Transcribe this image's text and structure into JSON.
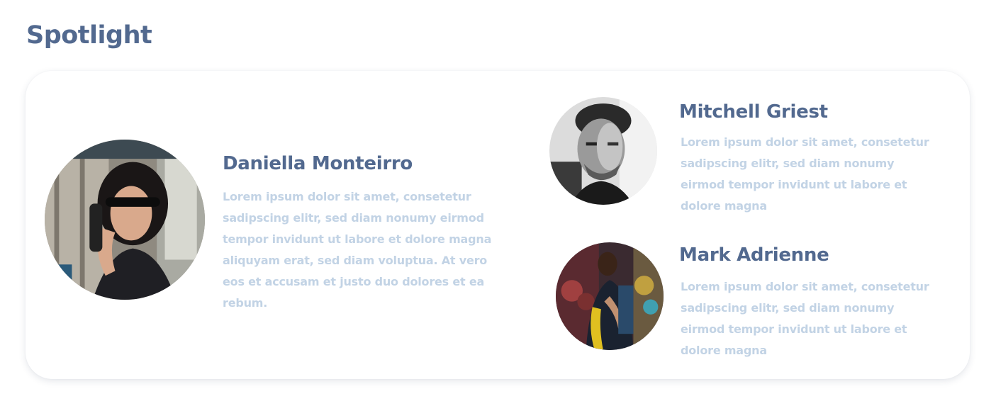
{
  "section": {
    "title": "Spotlight"
  },
  "people": [
    {
      "name": "Daniella Monteirro",
      "bio": "Lorem ipsum dolor sit amet, consetetur sadipscing elitr, sed diam nonumy eirmod tempor invidunt ut labore et dolore magna aliquyam erat, sed diam voluptua. At vero eos et accusam et justo duo dolores et ea rebum.",
      "avatar_icon": "portrait-photo"
    },
    {
      "name": "Mitchell Griest",
      "bio": "Lorem ipsum dolor sit amet, consetetur sadipscing elitr, sed diam nonumy eirmod tempor invidunt ut labore et dolore magna",
      "avatar_icon": "portrait-photo"
    },
    {
      "name": "Mark Adrienne",
      "bio": "Lorem ipsum dolor sit amet, consetetur sadipscing elitr, sed diam nonumy eirmod tempor invidunt ut labore et dolore magna",
      "avatar_icon": "portrait-photo"
    }
  ],
  "colors": {
    "title": "#52698f",
    "bio_text": "#c2d3e5",
    "card_bg": "#ffffff"
  }
}
